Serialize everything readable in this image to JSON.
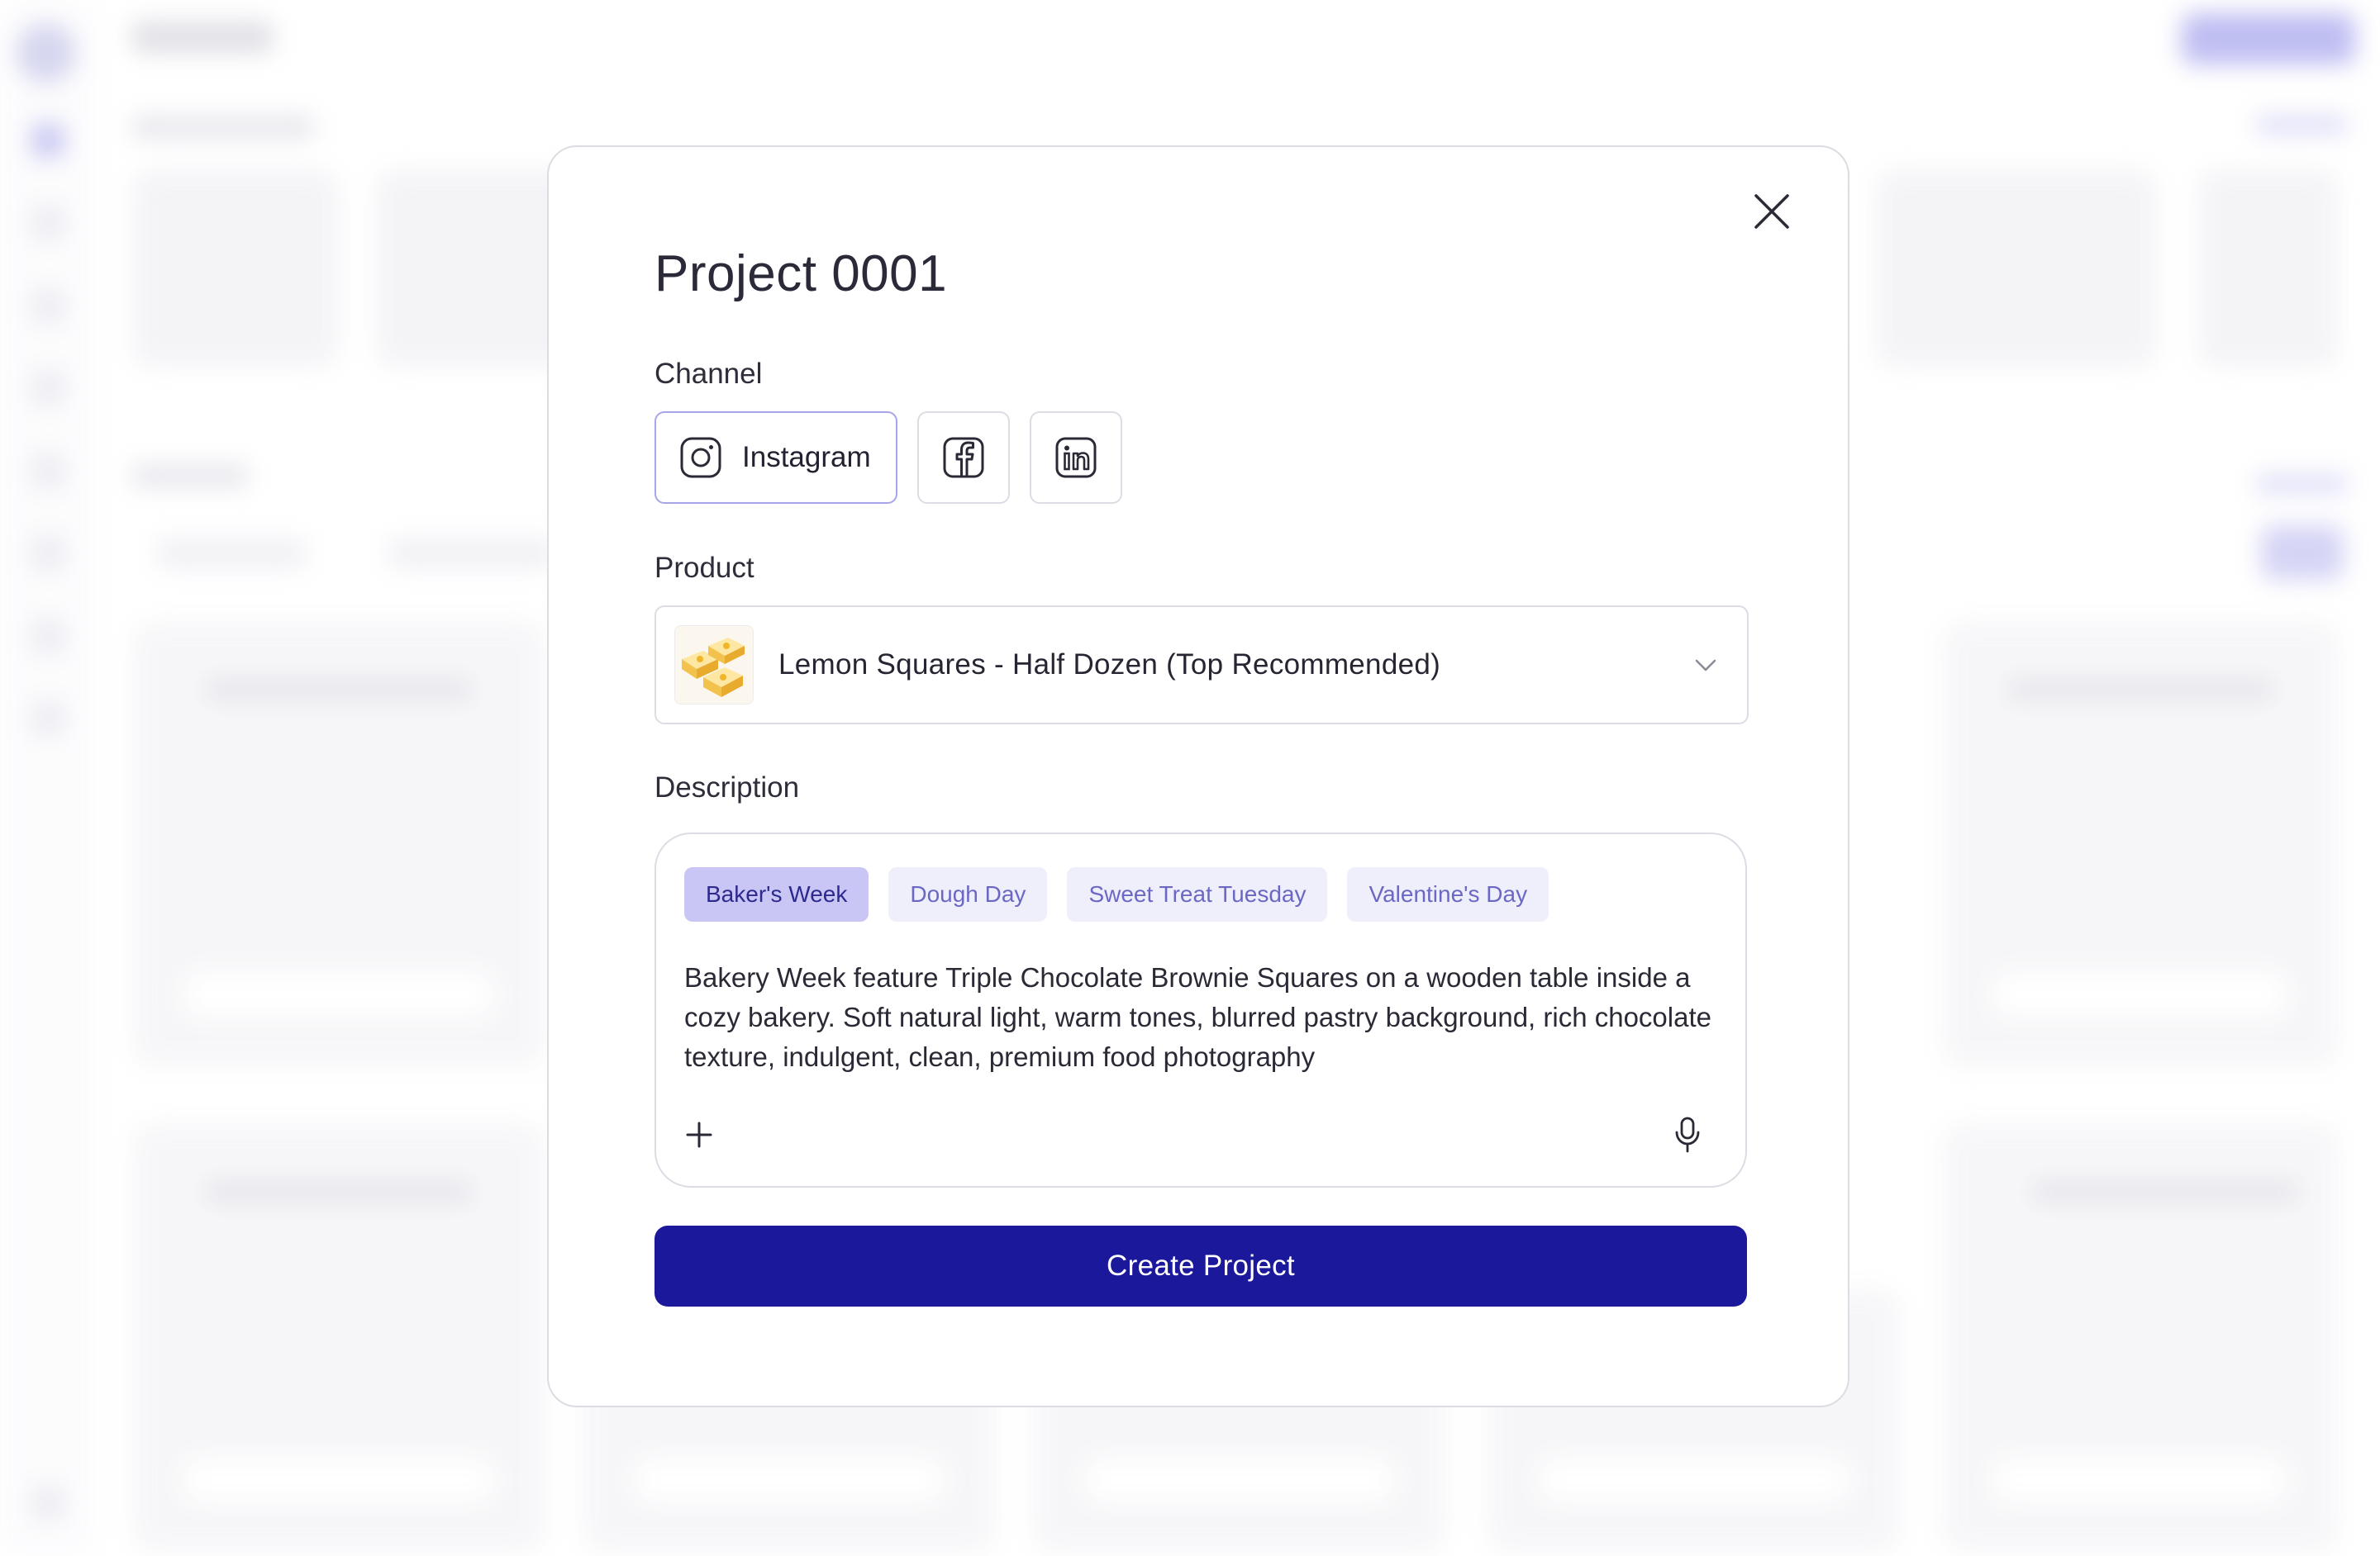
{
  "modal": {
    "title": "Project 0001",
    "channel_label": "Channel",
    "channels": [
      {
        "name": "Instagram",
        "icon": "instagram-icon",
        "selected": true
      },
      {
        "name": "",
        "icon": "facebook-icon",
        "selected": false
      },
      {
        "name": "",
        "icon": "linkedin-icon",
        "selected": false
      }
    ],
    "product_label": "Product",
    "product_selected": "Lemon Squares - Half Dozen (Top Recommended)",
    "description_label": "Description",
    "tags": [
      {
        "label": "Baker's Week",
        "active": true
      },
      {
        "label": "Dough Day",
        "active": false
      },
      {
        "label": "Sweet Treat Tuesday",
        "active": false
      },
      {
        "label": "Valentine's Day",
        "active": false
      }
    ],
    "description_text": "Bakery Week feature  Triple Chocolate Brownie Squares on a wooden table inside a cozy bakery. Soft natural light, warm tones, blurred pastry background, rich chocolate texture, indulgent, clean, premium food photography",
    "create_button": "Create Project"
  },
  "colors": {
    "accent": "#1c189c",
    "tag_active_bg": "#c9c6f6",
    "tag_bg": "#efeefb",
    "selected_border": "#a7a5ea"
  }
}
